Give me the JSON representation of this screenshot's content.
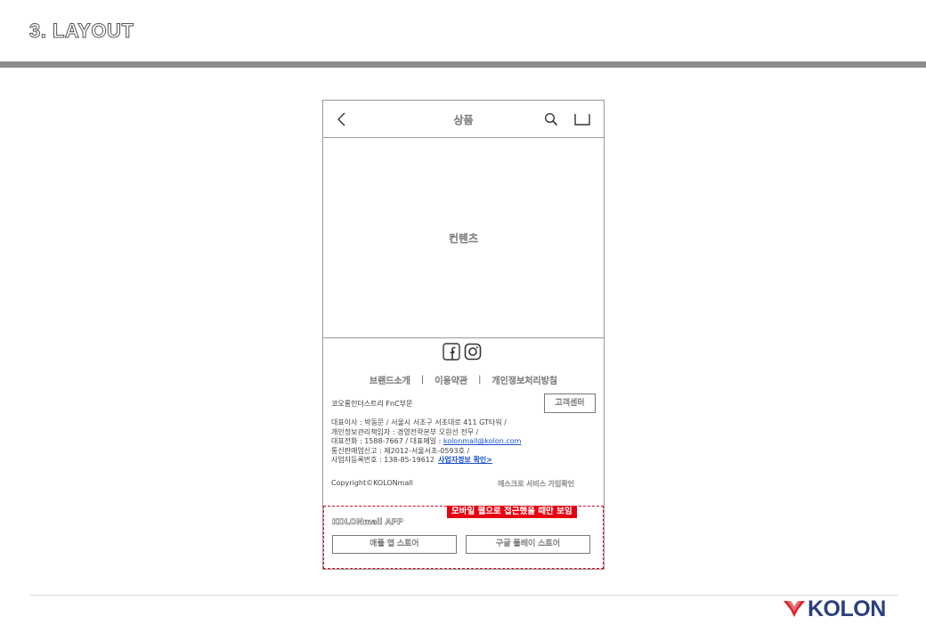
{
  "slide": {
    "title": "3. LAYOUT",
    "brand": "KOLON"
  },
  "header": {
    "title": "상품"
  },
  "content": {
    "label": "컨텐츠"
  },
  "social": {
    "icons": [
      "facebook-icon",
      "instagram-icon"
    ]
  },
  "footer": {
    "links": [
      "브랜드소개",
      "이용약관",
      "개인정보처리방침"
    ],
    "separator": "|",
    "company_name": "코오롱인더스트리 FnC부문",
    "cs_button": "고객센터",
    "info": {
      "ceo": "대표이사 : 박동문 / 서울시 서초구 서초대로 411 GT타워 /",
      "privacy_officer": "개인정보관리책임자 : 경영전략본부 오원선 전무 /",
      "phone_prefix": "대표전화 : 1588-7667 / 대표메일 : ",
      "email": "kolonmall@kolon.com",
      "mail_order": "통신판매업신고 : 제2012-서울서초-0593호  /",
      "biz_reg": "사업자등록번호 : 138-85-19612",
      "biz_link": "사업자정보 확인>"
    },
    "copyright": "Copyright©KOLONmall",
    "escrow": "에스크로 서비스 가입확인"
  },
  "app_banner": {
    "badge": "모바일 웹으로 접근했을 때만 보임",
    "title": "KOLONmall APP",
    "android_button": "애플 앱 스토어",
    "ios_button": "구글 플레이 스토어"
  },
  "colors": {
    "accent_red": "#e60012",
    "link_blue": "#1a4fd0",
    "brand_navy": "#2b3f7e",
    "brand_red": "#d9232e",
    "title_rule": "#8c8c8c"
  }
}
